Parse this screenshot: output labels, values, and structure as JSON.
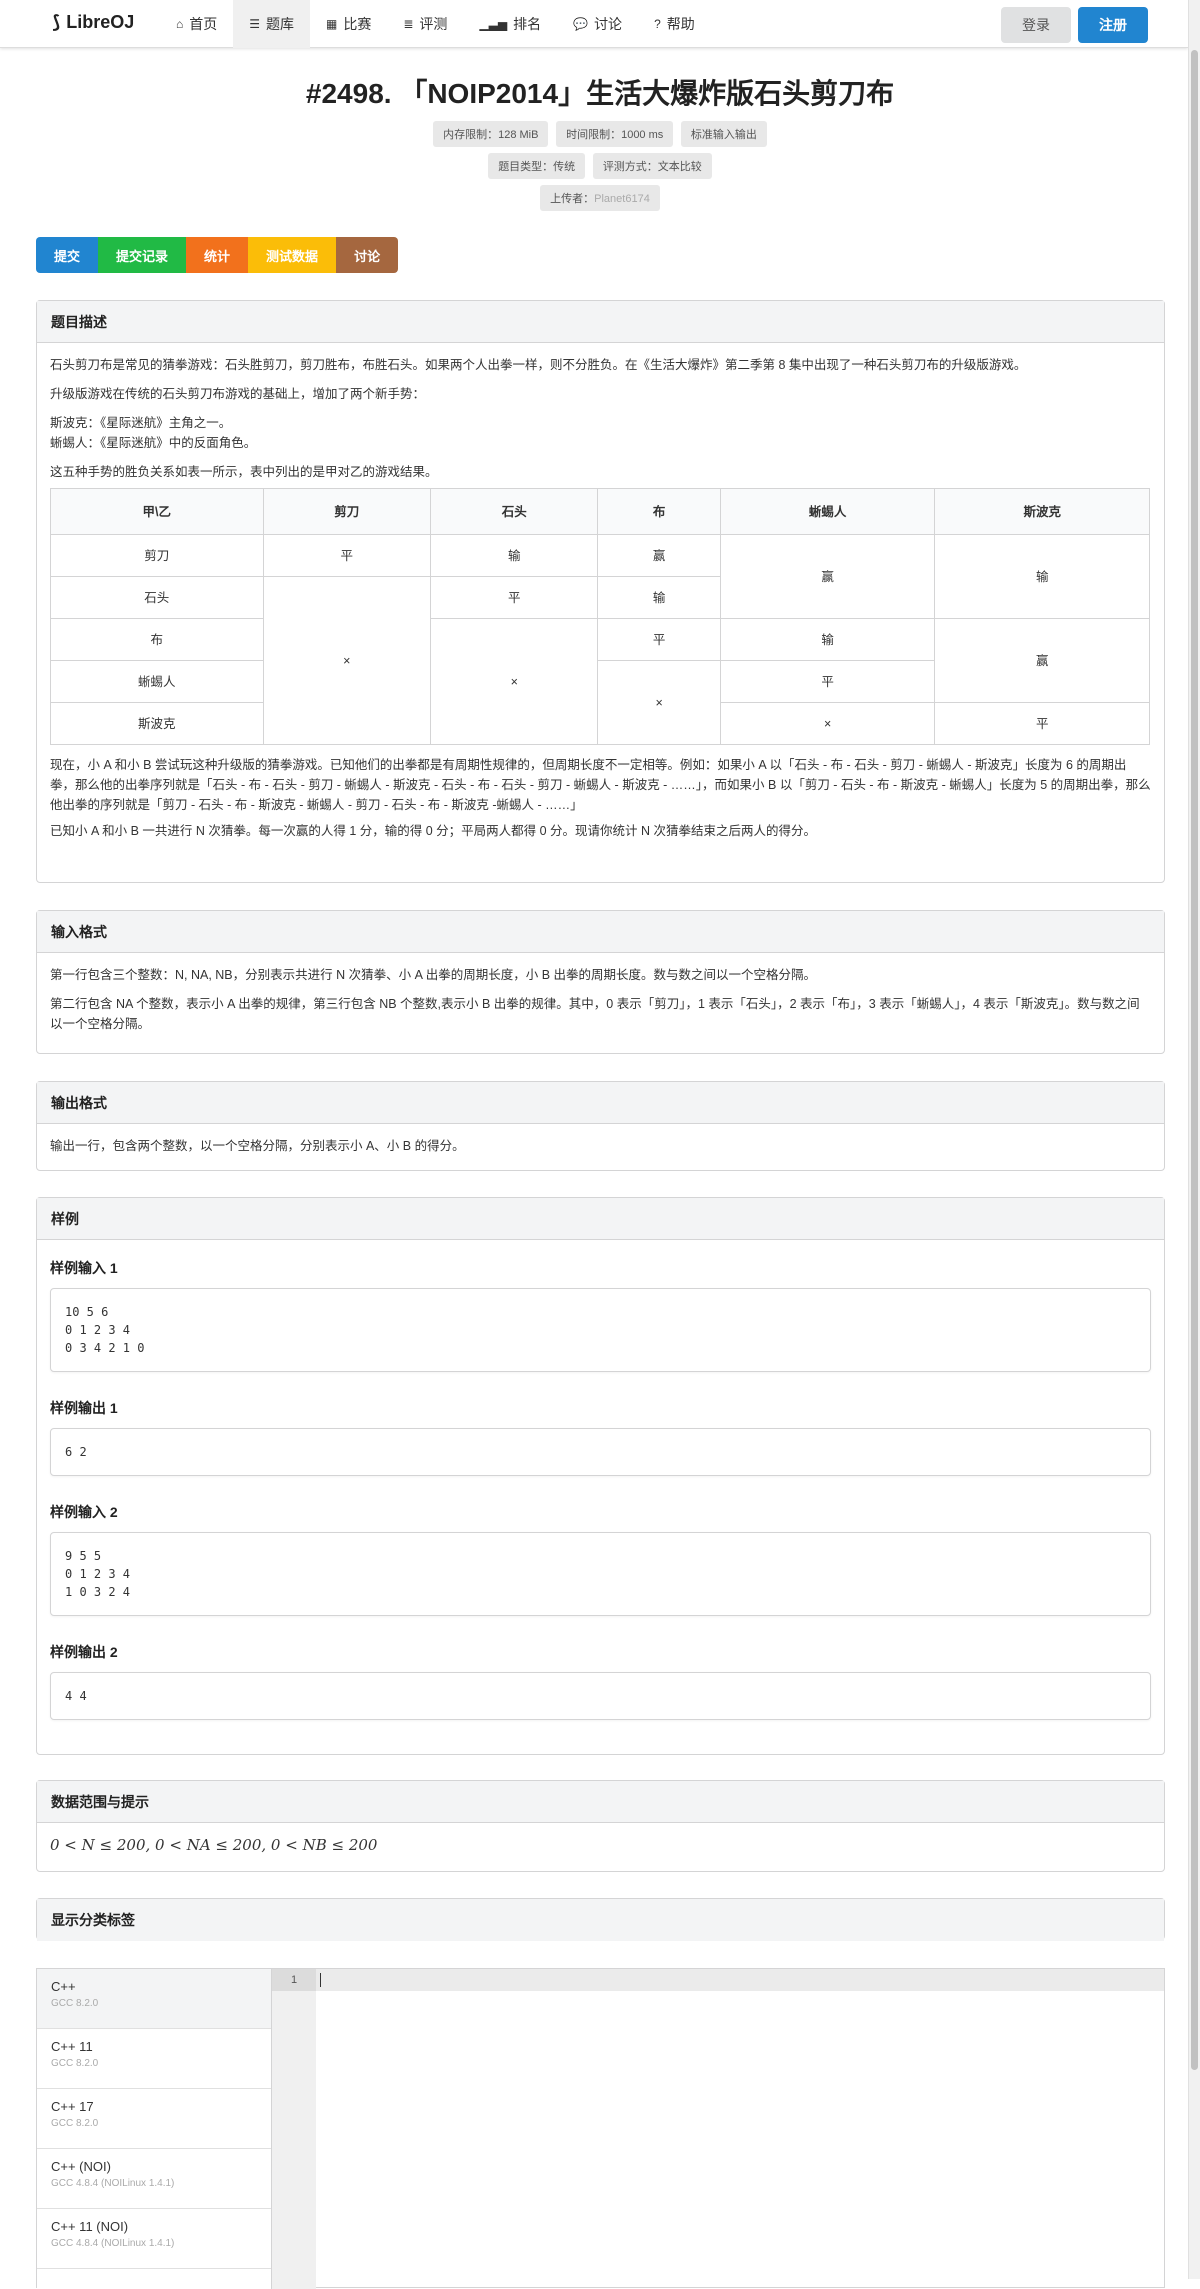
{
  "nav": {
    "logo": "LibreOJ",
    "items": [
      {
        "label": "首页",
        "icon": "home-icon"
      },
      {
        "label": "题库",
        "icon": "list-icon"
      },
      {
        "label": "比赛",
        "icon": "calendar-icon"
      },
      {
        "label": "评测",
        "icon": "tasks-icon"
      },
      {
        "label": "排名",
        "icon": "signal-icon"
      },
      {
        "label": "讨论",
        "icon": "comments-icon"
      },
      {
        "label": "帮助",
        "icon": "help-icon"
      }
    ],
    "login": "登录",
    "register": "注册"
  },
  "problem": {
    "title": "#2498. 「NOIP2014」生活大爆炸版石头剪刀布",
    "labels_row1": [
      "内存限制：128 MiB",
      "时间限制：1000 ms",
      "标准输入输出"
    ],
    "labels_row2": [
      "题目类型：传统",
      "评测方式：文本比较"
    ],
    "uploader_label": "上传者：",
    "uploader": "Planet6174"
  },
  "actions": [
    "提交",
    "提交记录",
    "统计",
    "测试数据",
    "讨论"
  ],
  "description": {
    "heading": "题目描述",
    "p1": "石头剪刀布是常见的猜拳游戏：石头胜剪刀，剪刀胜布，布胜石头。如果两个人出拳一样，则不分胜负。在《生活大爆炸》第二季第 8 集中出现了一种石头剪刀布的升级版游戏。",
    "p2": "升级版游戏在传统的石头剪刀布游戏的基础上，增加了两个新手势：",
    "p3a": "斯波克：《星际迷航》主角之一。",
    "p3b": "蜥蜴人：《星际迷航》中的反面角色。",
    "p4": "这五种手势的胜负关系如表一所示，表中列出的是甲对乙的游戏结果。",
    "table": {
      "headers": [
        "甲\\乙",
        "剪刀",
        "石头",
        "布",
        "蜥蜴人",
        "斯波克"
      ],
      "rows": [
        "剪刀",
        "石头",
        "布",
        "蜥蜴人",
        "斯波克"
      ],
      "c_r1_scissor": "平",
      "c_r1_stone": "输",
      "c_r1_cloth": "赢",
      "c_r12_lizard": "赢",
      "c_r12_spock": "输",
      "c_r2_stone": "平",
      "c_r2_cloth": "输",
      "c_r3_cloth": "平",
      "c_r3_lizard": "输",
      "c_r345_scissor": "×",
      "c_r345_stone": "×",
      "c_r34_spock": "赢",
      "c_r45_cloth": "×",
      "c_r4_lizard": "平",
      "c_r5_lizard": "×",
      "c_r5_spock": "平"
    },
    "p5": "现在，小 A 和小 B 尝试玩这种升级版的猜拳游戏。已知他们的出拳都是有周期性规律的，但周期长度不一定相等。例如：如果小 A 以「石头 - 布 - 石头 - 剪刀 - 蜥蜴人 - 斯波克」长度为 6 的周期出拳，那么他的出拳序列就是「石头 - 布 - 石头 - 剪刀 - 蜥蜴人 - 斯波克 - 石头 - 布 - 石头 - 剪刀 - 蜥蜴人 - 斯波克 - ……」，而如果小 B 以「剪刀 - 石头 - 布 - 斯波克 - 蜥蜴人」长度为 5 的周期出拳，那么他出拳的序列就是「剪刀 - 石头 - 布 - 斯波克 - 蜥蜴人 - 剪刀 - 石头 - 布 - 斯波克 -蜥蜴人 - ……」",
    "p6": "已知小 A 和小 B 一共进行 N 次猜拳。每一次赢的人得 1 分，输的得 0 分；平局两人都得 0 分。现请你统计 N 次猜拳结束之后两人的得分。"
  },
  "input_format": {
    "heading": "输入格式",
    "p1": "第一行包含三个整数：N, NA, NB，分别表示共进行 N 次猜拳、小 A 出拳的周期长度，小 B 出拳的周期长度。数与数之间以一个空格分隔。",
    "p2": "第二行包含 NA 个整数，表示小 A 出拳的规律，第三行包含 NB 个整数,表示小 B 出拳的规律。其中，0 表示「剪刀」，1 表示「石头」，2 表示「布」，3 表示「蜥蜴人」，4 表示「斯波克」。数与数之间以一个空格分隔。"
  },
  "output_format": {
    "heading": "输出格式",
    "p1": "输出一行，包含两个整数，以一个空格分隔，分别表示小 A、小 B 的得分。"
  },
  "samples": {
    "heading": "样例",
    "in1_label": "样例输入 1",
    "in1": "10 5 6\n0 1 2 3 4\n0 3 4 2 1 0",
    "out1_label": "样例输出 1",
    "out1": "6 2",
    "in2_label": "样例输入 2",
    "in2": "9 5 5\n0 1 2 3 4\n1 0 3 2 4",
    "out2_label": "样例输出 2",
    "out2": "4 4"
  },
  "limits": {
    "heading": "数据范围与提示",
    "text": "0 < N ≤ 200, 0 < NA ≤ 200, 0 < NB ≤ 200"
  },
  "tags": {
    "heading": "显示分类标签"
  },
  "editor": {
    "languages": [
      {
        "name": "C++",
        "version": "GCC 8.2.0"
      },
      {
        "name": "C++ 11",
        "version": "GCC 8.2.0"
      },
      {
        "name": "C++ 17",
        "version": "GCC 8.2.0"
      },
      {
        "name": "C++ (NOI)",
        "version": "GCC 4.8.4 (NOILinux 1.4.1)"
      },
      {
        "name": "C++ 11 (NOI)",
        "version": "GCC 4.8.4 (NOILinux 1.4.1)"
      }
    ],
    "line_number": "1"
  }
}
